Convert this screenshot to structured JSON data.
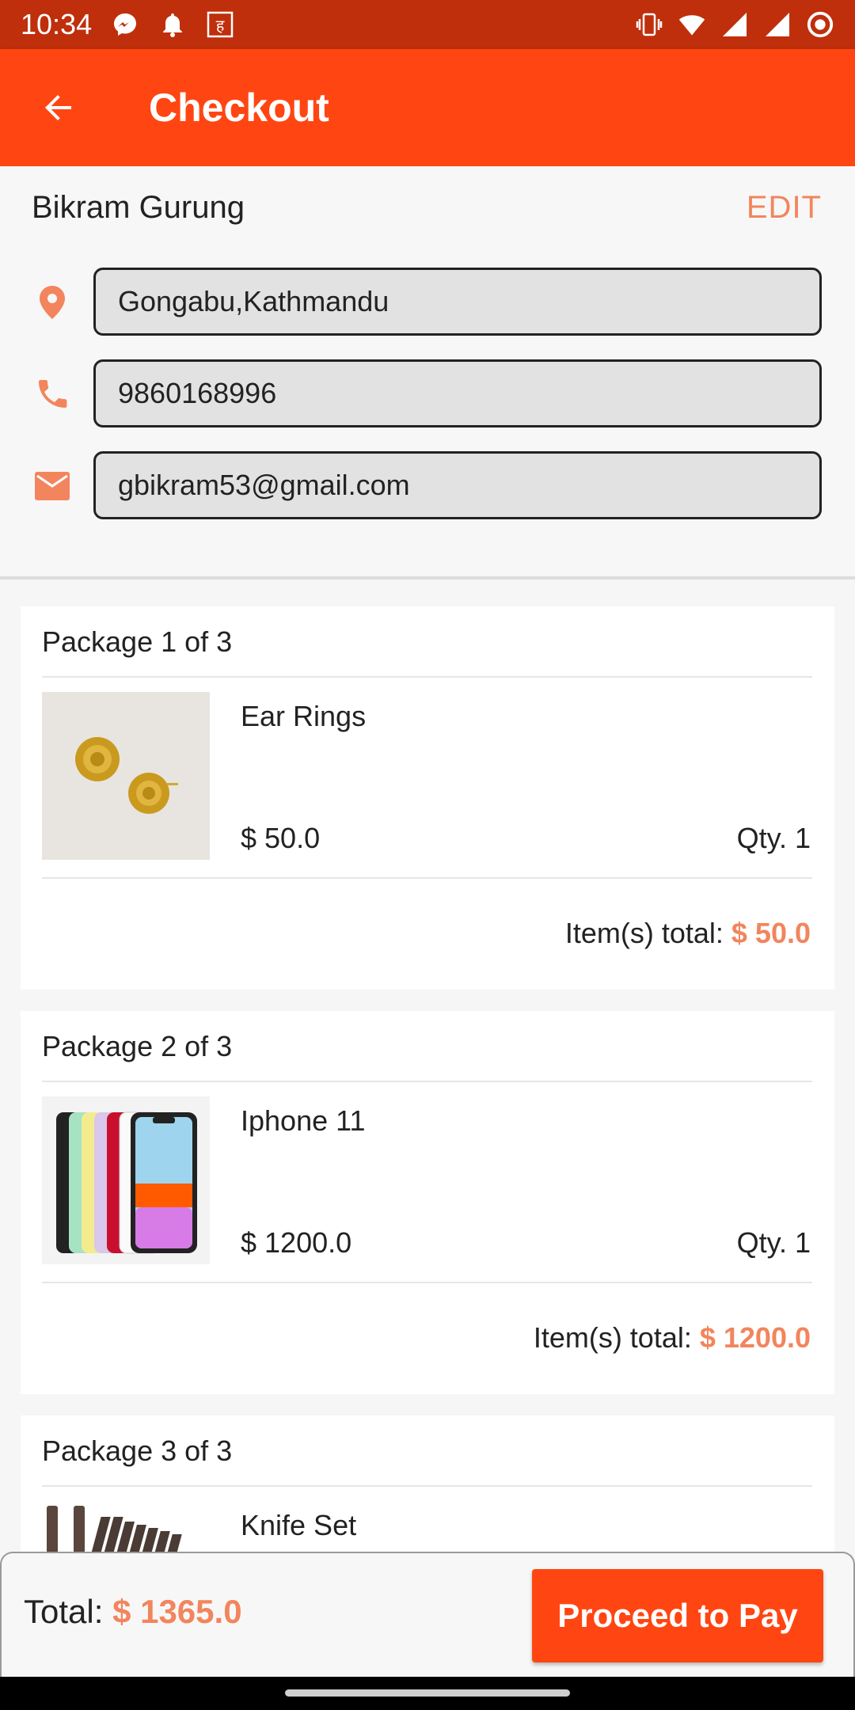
{
  "status_bar": {
    "time": "10:34",
    "left_icons": [
      "messenger-icon",
      "bell-icon",
      "rupee-icon"
    ],
    "right_icons": [
      "vibrate-icon",
      "wifi-icon",
      "signal-icon",
      "signal-icon",
      "circle-record-icon"
    ]
  },
  "appbar": {
    "title": "Checkout"
  },
  "user": {
    "name": "Bikram Gurung",
    "edit_label": "EDIT",
    "address": "Gongabu,Kathmandu",
    "phone": "9860168996",
    "email": "gbikram53@gmail.com"
  },
  "packages": [
    {
      "title": "Package 1 of 3",
      "item": "Ear Rings",
      "price": "$ 50.0",
      "qty": "Qty. 1",
      "total_label": "Item(s) total: ",
      "total": "$ 50.0"
    },
    {
      "title": "Package 2 of 3",
      "item": "Iphone 11",
      "price": "$ 1200.0",
      "qty": "Qty. 1",
      "total_label": "Item(s) total: ",
      "total": "$ 1200.0"
    },
    {
      "title": "Package 3 of 3",
      "item": "Knife Set"
    }
  ],
  "footer": {
    "total_label": "Total: ",
    "total": "$ 1365.0",
    "pay_label": "Proceed to Pay"
  },
  "colors": {
    "primary": "#ff4612",
    "status_bar": "#bf2f0c",
    "accent": "#f2855d"
  }
}
